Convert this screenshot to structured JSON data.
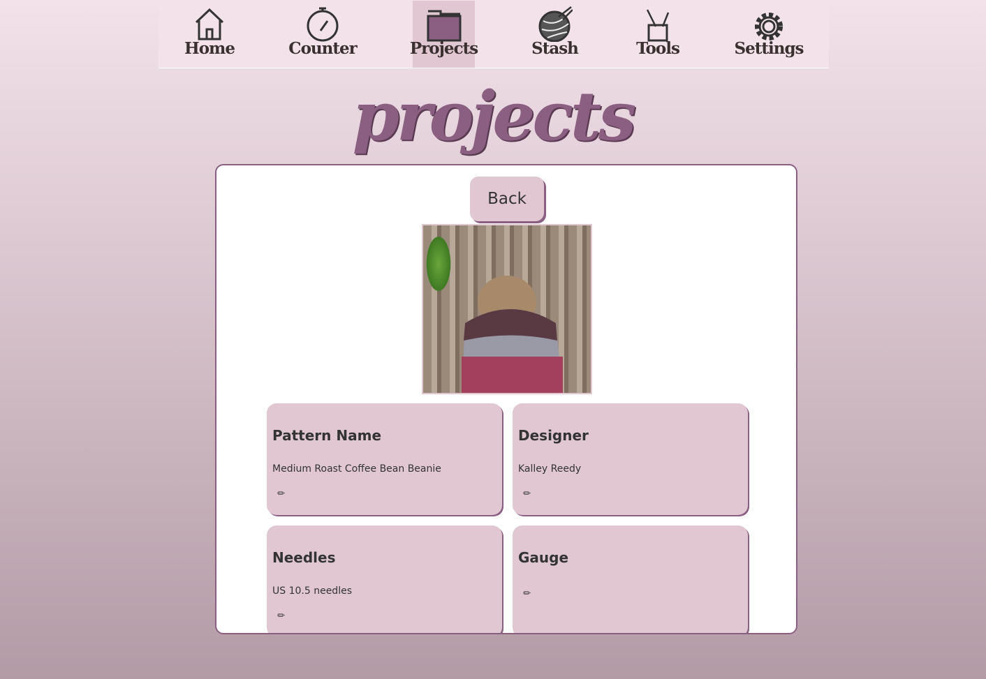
{
  "nav": {
    "items": [
      {
        "label": "Home"
      },
      {
        "label": "Counter"
      },
      {
        "label": "Projects"
      },
      {
        "label": "Stash"
      },
      {
        "label": "Tools"
      },
      {
        "label": "Settings"
      }
    ],
    "active": "Projects"
  },
  "page": {
    "title": "projects",
    "back_label": "Back"
  },
  "cards": [
    {
      "label": "Pattern Name",
      "value": "Medium Roast Coffee Bean Beanie"
    },
    {
      "label": "Designer",
      "value": "Kalley Reedy"
    },
    {
      "label": "Needles",
      "value": "US 10.5 needles"
    },
    {
      "label": "Gauge",
      "value": ""
    }
  ],
  "colors": {
    "accent": "#8b5f82",
    "card": "#e0c7d2"
  }
}
